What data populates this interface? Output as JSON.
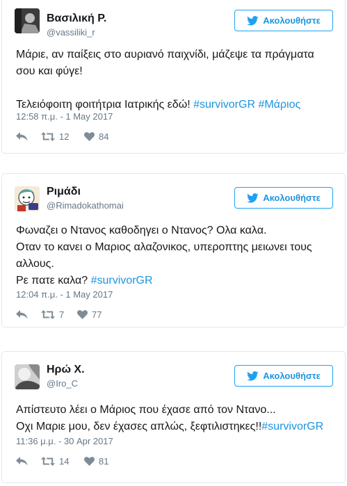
{
  "colors": {
    "accent": "#1b95e0",
    "muted": "#657786",
    "text": "#14171a",
    "border": "#e1e8ed"
  },
  "icons": {
    "follow": "twitter-bird-icon",
    "reply": "reply-icon",
    "retweet": "retweet-icon",
    "like": "heart-icon"
  },
  "tweets": [
    {
      "name": "Βασιλική Ρ.",
      "handle": "@vassiliki_r",
      "follow_label": "Ακολουθήστε",
      "text_line1": "Μάριε, αν παίξεις στο αυριανό παιχνίδι, μάζεψε τα πράγματα σου και φύγε!",
      "text_line2": "Τελειόφοιτη φοιτήτρια Ιατρικής εδώ! ",
      "hashtag1": "#survivorGR",
      "hashtag2": "#Μάριος",
      "timestamp": "12:58 π.μ. - 1 May 2017",
      "retweets": "12",
      "likes": "84"
    },
    {
      "name": "Ριμάδι",
      "handle": "@Rimadokathomai",
      "follow_label": "Ακολουθήστε",
      "text_line1": "Φωναζει ο Ντανος καθοδηγει ο Ντανος? Ολα καλα.",
      "text_line2": "Οταν το κανει ο Μαριος αλαζονικος, υπεροπτης μειωνει τους αλλους.",
      "text_line3": "Ρε πατε καλα? ",
      "hashtag1": "#survivorGR",
      "timestamp": "12:04 π.μ. - 1 May 2017",
      "retweets": "7",
      "likes": "77"
    },
    {
      "name": "Ηρώ Χ.",
      "handle": "@Iro_C",
      "follow_label": "Ακολουθήστε",
      "text_line1": "Απίστευτο λέει ο Μάριος που έχασε από τον Ντανο...",
      "text_line2": "Οχι Μαριε μου, δεν έχασες απλώς, ξεφτιλιστηκες!!",
      "hashtag1": "#survivorGR",
      "timestamp": "11:36 μ.μ. - 30 Apr 2017",
      "retweets": "14",
      "likes": "81"
    }
  ]
}
